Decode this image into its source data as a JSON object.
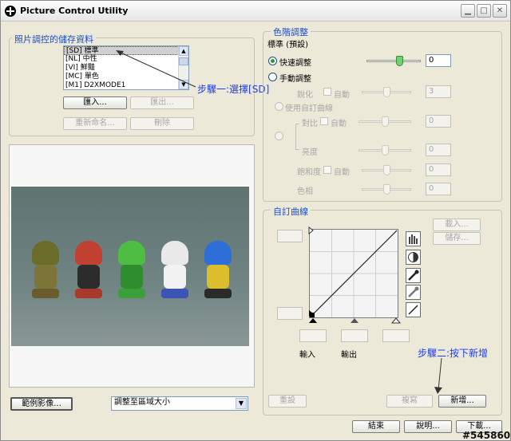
{
  "window": {
    "title": "Picture Control Utility"
  },
  "storage": {
    "legend": "照片調控的儲存資料",
    "items": [
      "[SD] 標準",
      "[NL] 中性",
      "[VI] 鮮豔",
      "[MC] 單色",
      "[M1] D2XMODE1"
    ],
    "import_label": "匯入...",
    "export_label": "匯出...",
    "rename_label": "重新命名...",
    "delete_label": "刪除"
  },
  "preview": {
    "sample_label": "範例影像...",
    "fit_option": "調整至區域大小"
  },
  "tone": {
    "legend": "色階調整",
    "subtitle": "標準 (預設)",
    "quick_label": "快速調整",
    "quick_value": "0",
    "manual_label": "手動調整",
    "sharpen_label": "銳化",
    "auto_label": "自動",
    "sharpen_value": "3",
    "custom_curve_label": "使用自訂曲線",
    "contrast_label": "對比",
    "contrast_value": "0",
    "brightness_label": "亮度",
    "brightness_value": "0",
    "saturation_label": "飽和度",
    "saturation_value": "0",
    "hue_label": "色相",
    "hue_value": "0",
    "quick_level": 0.62,
    "sharpen_level": 0.5,
    "contrast_level": 0.5,
    "brightness_level": 0.5,
    "saturation_level": 0.5,
    "hue_level": 0.5
  },
  "curve": {
    "legend": "自訂曲線",
    "load_label": "載入...",
    "save_label": "儲存...",
    "input_label": "輸入",
    "output_label": "輸出",
    "reset_label": "重設",
    "copy_label": "複寫",
    "new_label": "新增..."
  },
  "footer": {
    "close_label": "結束",
    "help_label": "說明...",
    "download_label": "下載..."
  },
  "annotations": {
    "step1": "步驟一:選擇[SD]",
    "step2": "步驟二:按下新增"
  },
  "watermark": "#545860",
  "icons": [
    "app-icon",
    "minimize-icon",
    "maximize-icon",
    "close-icon",
    "scroll-up-icon",
    "scroll-down-icon",
    "histogram-icon",
    "contrast-icon",
    "eyedropper-black-icon",
    "eyedropper-gray-icon",
    "eyedropper-white-icon",
    "linear-reset-icon",
    "chevron-down-icon"
  ]
}
